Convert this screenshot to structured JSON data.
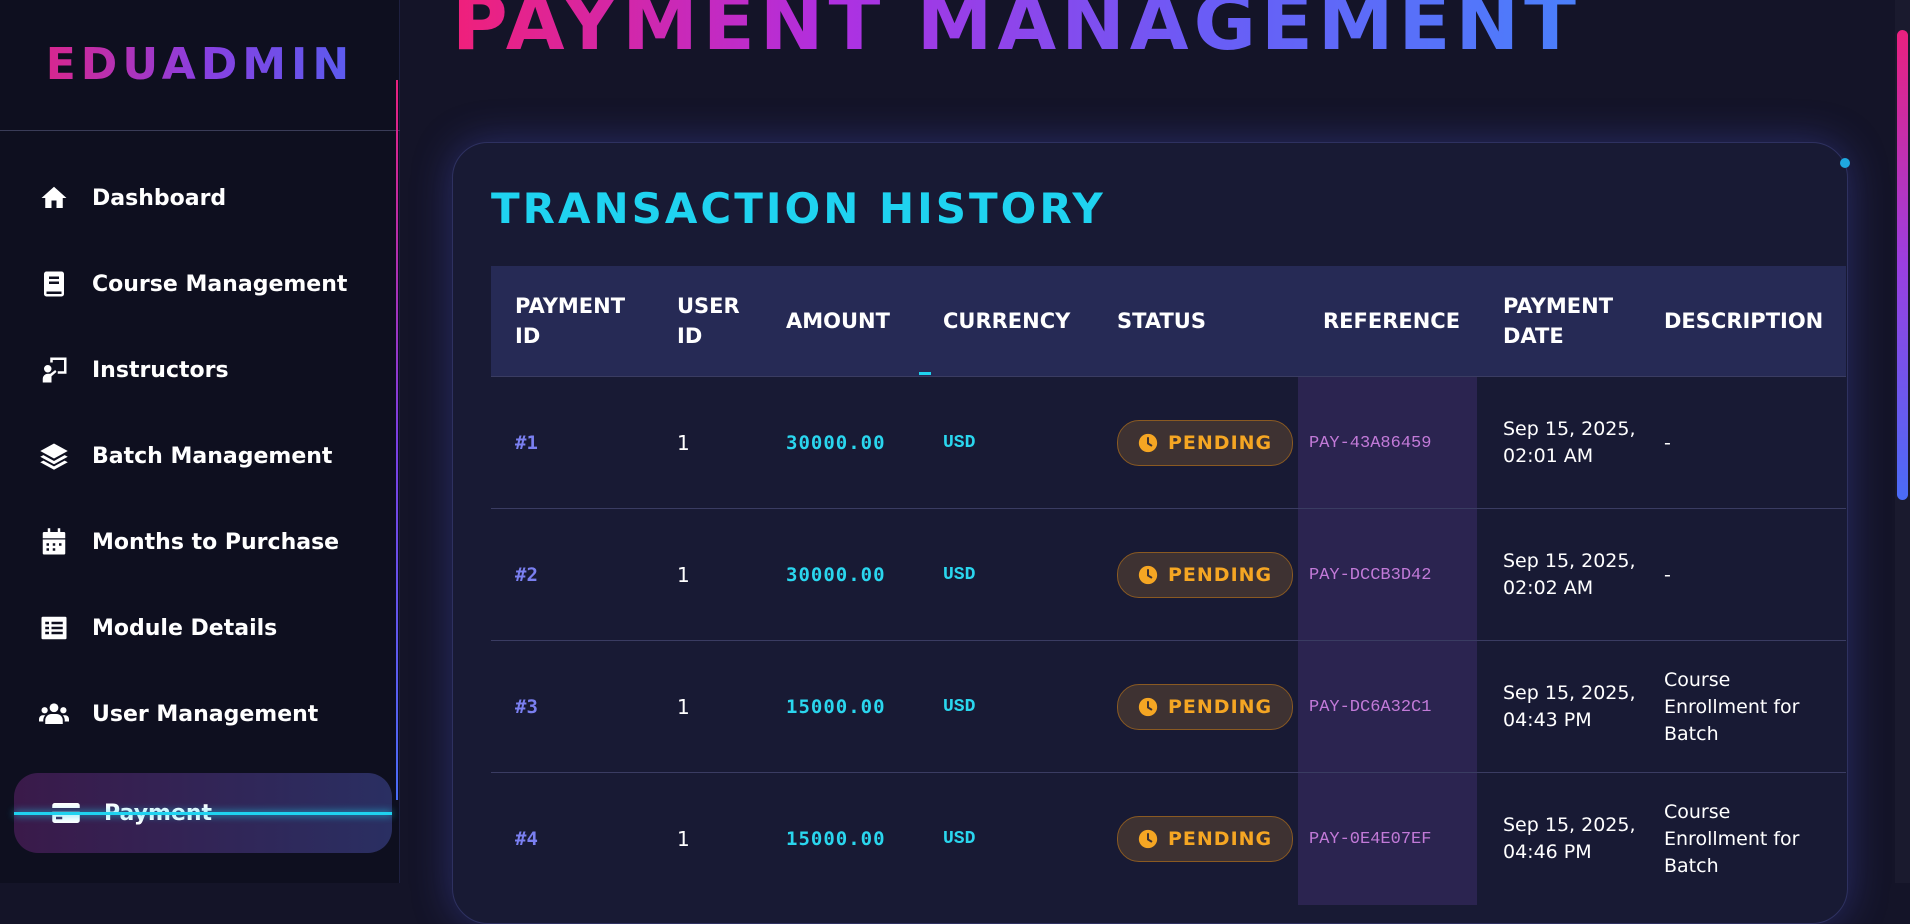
{
  "brand": "EDUADMIN",
  "page_title": "PAYMENT MANAGEMENT",
  "sidebar": {
    "items": [
      {
        "label": "Dashboard",
        "icon": "home-icon"
      },
      {
        "label": "Course Management",
        "icon": "book-icon"
      },
      {
        "label": "Instructors",
        "icon": "chalkboard-teacher-icon"
      },
      {
        "label": "Batch Management",
        "icon": "layers-icon"
      },
      {
        "label": "Months to Purchase",
        "icon": "calendar-icon"
      },
      {
        "label": "Module Details",
        "icon": "list-icon"
      },
      {
        "label": "User Management",
        "icon": "users-icon"
      },
      {
        "label": "Payment",
        "icon": "credit-card-icon",
        "active": true
      }
    ]
  },
  "card": {
    "title": "TRANSACTION HISTORY"
  },
  "table": {
    "headers": {
      "payment_id": "PAYMENT ID",
      "user_id": "USER ID",
      "amount": "AMOUNT",
      "currency": "CURRENCY",
      "status": "STATUS",
      "reference": "REFERENCE",
      "payment_date": "PAYMENT DATE",
      "description": "DESCRIPTION"
    },
    "rows": [
      {
        "payment_id": "#1",
        "user_id": "1",
        "amount": "30000.00",
        "currency": "USD",
        "status": "PENDING",
        "reference": "PAY-43A86459",
        "payment_date": "Sep 15, 2025, 02:01 AM",
        "description": "-"
      },
      {
        "payment_id": "#2",
        "user_id": "1",
        "amount": "30000.00",
        "currency": "USD",
        "status": "PENDING",
        "reference": "PAY-DCCB3D42",
        "payment_date": "Sep 15, 2025, 02:02 AM",
        "description": "-"
      },
      {
        "payment_id": "#3",
        "user_id": "1",
        "amount": "15000.00",
        "currency": "USD",
        "status": "PENDING",
        "reference": "PAY-DC6A32C1",
        "payment_date": "Sep 15, 2025, 04:43 PM",
        "description": "Course Enrollment for Batch"
      },
      {
        "payment_id": "#4",
        "user_id": "1",
        "amount": "15000.00",
        "currency": "USD",
        "status": "PENDING",
        "reference": "PAY-0E4E07EF",
        "payment_date": "Sep 15, 2025, 04:46 PM",
        "description": "Course Enrollment for Batch"
      }
    ]
  },
  "colors": {
    "accent_cyan": "#1fd3f0",
    "status_pending": "#f5a623",
    "reference_text": "#c27ad8",
    "id_text": "#7a7ff0"
  }
}
